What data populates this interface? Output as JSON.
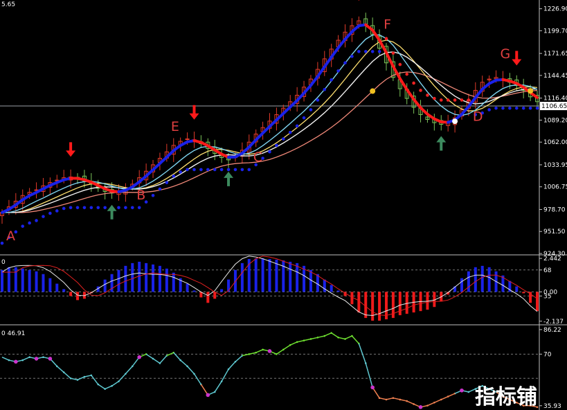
{
  "colors": {
    "background": "#000000",
    "bull_candle": "#e03a2a",
    "bear_candle": "#7cc45a",
    "ma_fast_up": "#1a22e8",
    "ma_fast_down": "#ff1a1a",
    "ma_cyan": "#7fd3ef",
    "ma_white": "#f0f0f0",
    "ma_yellow": "#ffe070",
    "ma_salmon": "#f08878",
    "dots_blue": "#1a22e8",
    "dots_red": "#ee2222",
    "arrow_down": "#ff1a1a",
    "arrow_up": "#3c8a5e",
    "letter": "#e04040",
    "hist_pos": "#1a22e8",
    "hist_neg": "#ee1a1a",
    "osc_line_white": "#e8e8e8",
    "osc_line_red": "#e02020",
    "rsi_up": "#6ee030",
    "rsi_mid": "#5ec8d0",
    "rsi_down": "#f08050",
    "rsi_marker": "#cc33cc"
  },
  "header": {
    "main_corner": "5.65",
    "osc_corner": "0",
    "rsi_corner": "0 46.91"
  },
  "watermark": "指标铺",
  "chart_data": [
    {
      "type": "candlestick",
      "panel": "price",
      "ylim": [
        924.3,
        1236.0
      ],
      "yticks": [
        "1226.90",
        "1199.70",
        "1171.65",
        "1144.45",
        "1116.40",
        "1089.20",
        "1062.00",
        "1033.95",
        "1006.75",
        "978.70",
        "951.50",
        "924.30"
      ],
      "current_price": "1106.65",
      "letters": [
        "A",
        "B",
        "C",
        "D",
        "E",
        "F",
        "G"
      ],
      "close": [
        975,
        982,
        989,
        996,
        1000,
        1003,
        1008,
        1012,
        1015,
        1018,
        1019,
        1017,
        1014,
        1010,
        1005,
        1001,
        999,
        1000,
        1004,
        1010,
        1018,
        1026,
        1034,
        1042,
        1050,
        1058,
        1063,
        1066,
        1065,
        1060,
        1054,
        1048,
        1043,
        1040,
        1044,
        1052,
        1062,
        1072,
        1080,
        1088,
        1096,
        1104,
        1112,
        1120,
        1130,
        1140,
        1152,
        1165,
        1177,
        1188,
        1198,
        1206,
        1212,
        1208,
        1195,
        1178,
        1160,
        1142,
        1128,
        1116,
        1105,
        1096,
        1090,
        1086,
        1084,
        1086,
        1092,
        1102,
        1114,
        1126,
        1136,
        1140,
        1142,
        1140,
        1136,
        1132,
        1126,
        1118,
        1112
      ]
    },
    {
      "type": "histogram",
      "panel": "oscillator",
      "yticks": [
        "2.442",
        "68",
        "0.00",
        "35",
        "-2.137"
      ],
      "ylim": [
        -2.3,
        2.6
      ],
      "values": [
        1.6,
        1.8,
        1.8,
        1.7,
        1.6,
        1.5,
        1.3,
        1.0,
        0.6,
        0.2,
        -0.3,
        -0.6,
        -0.5,
        -0.1,
        0.4,
        0.9,
        1.3,
        1.6,
        1.9,
        2.1,
        2.2,
        2.1,
        2.0,
        1.9,
        1.7,
        1.4,
        1.0,
        0.6,
        0.1,
        -0.4,
        -0.8,
        -0.5,
        0.2,
        0.9,
        1.6,
        2.1,
        2.4,
        2.44,
        2.44,
        2.4,
        2.35,
        2.3,
        2.2,
        2.1,
        1.9,
        1.6,
        1.3,
        0.9,
        0.5,
        0.1,
        -0.3,
        -0.9,
        -1.5,
        -1.9,
        -2.1,
        -2.1,
        -2.0,
        -1.9,
        -1.7,
        -1.6,
        -1.5,
        -1.4,
        -1.3,
        -1.1,
        -0.7,
        -0.2,
        0.4,
        1.0,
        1.5,
        1.8,
        1.9,
        1.8,
        1.5,
        1.2,
        0.8,
        0.4,
        -0.1,
        -0.8,
        -1.4
      ]
    },
    {
      "type": "line",
      "panel": "rsi",
      "yticks": [
        "86.22",
        "70",
        "35.93"
      ],
      "ylim": [
        34.0,
        88.0
      ],
      "values": [
        68,
        66,
        65,
        66,
        68,
        67,
        68,
        67,
        62,
        58,
        54,
        53,
        55,
        56,
        50,
        47,
        49,
        52,
        57,
        62,
        68,
        70,
        67,
        64,
        69,
        71,
        66,
        62,
        57,
        50,
        43,
        45,
        52,
        60,
        65,
        69,
        70,
        71,
        73,
        72,
        70,
        73,
        76,
        78,
        79,
        80,
        81,
        82,
        84,
        81,
        80,
        82,
        77,
        64,
        48,
        41,
        40,
        41,
        40,
        39,
        37,
        35,
        36,
        38,
        40,
        42,
        44,
        46,
        45,
        47,
        49,
        47,
        45,
        42,
        40,
        38,
        36,
        36,
        35
      ]
    }
  ]
}
